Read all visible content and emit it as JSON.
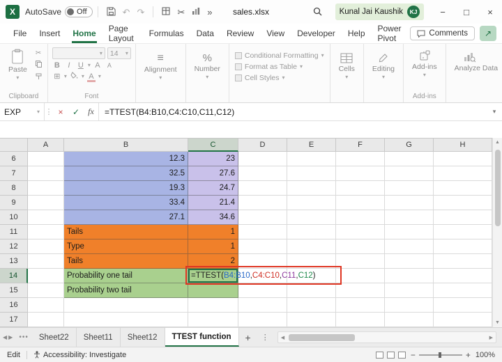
{
  "titlebar": {
    "autosave_label": "AutoSave",
    "autosave_state": "Off",
    "filename": "sales.xlsx",
    "user_name": "Kunal Jai Kaushik",
    "user_initials": "KJ"
  },
  "menubar": {
    "tabs": [
      {
        "label": "File",
        "active": false
      },
      {
        "label": "Insert",
        "active": false
      },
      {
        "label": "Home",
        "active": true
      },
      {
        "label": "Page Layout",
        "active": false
      },
      {
        "label": "Formulas",
        "active": false
      },
      {
        "label": "Data",
        "active": false
      },
      {
        "label": "Review",
        "active": false
      },
      {
        "label": "View",
        "active": false
      },
      {
        "label": "Developer",
        "active": false
      },
      {
        "label": "Help",
        "active": false
      },
      {
        "label": "Power Pivot",
        "active": false
      }
    ],
    "comments_label": "Comments"
  },
  "ribbon": {
    "paste_label": "Paste",
    "clipboard_label": "Clipboard",
    "font_label": "Font",
    "font_name": "",
    "font_size": "14",
    "bold": "B",
    "italic": "I",
    "underline": "U",
    "grow_font": "A",
    "shrink_font": "A",
    "borders_icon": "⊞",
    "alignment_label": "Alignment",
    "number_label": "Number",
    "percent_icon": "%",
    "styles": [
      "Conditional Formatting",
      "Format as Table",
      "Cell Styles"
    ],
    "cells_label": "Cells",
    "editing_label": "Editing",
    "addins_label": "Add-ins",
    "addins_group_label": "Add-ins",
    "analyze_label": "Analyze Data"
  },
  "formula_bar": {
    "name_box": "EXP",
    "formula": "=TTEST(B4:B10,C4:C10,C11,C12)"
  },
  "grid": {
    "columns": [
      "A",
      "B",
      "C",
      "D",
      "E",
      "F",
      "G",
      "H"
    ],
    "selected_cell": "C14",
    "rows": [
      {
        "num": "6",
        "b": "12.3",
        "c": "23",
        "fill": "blue"
      },
      {
        "num": "7",
        "b": "32.5",
        "c": "27.6",
        "fill": "blue"
      },
      {
        "num": "8",
        "b": "19.3",
        "c": "24.7",
        "fill": "blue"
      },
      {
        "num": "9",
        "b": "33.4",
        "c": "21.4",
        "fill": "blue"
      },
      {
        "num": "10",
        "b": "27.1",
        "c": "34.6",
        "fill": "blue"
      },
      {
        "num": "11",
        "b": "Tails",
        "c": "1",
        "fill": "orange"
      },
      {
        "num": "12",
        "b": "Type",
        "c": "1",
        "fill": "orange"
      },
      {
        "num": "13",
        "b": "Tails",
        "c": "2",
        "fill": "orange"
      },
      {
        "num": "14",
        "b": "Probability one tail",
        "c": "",
        "fill": "green",
        "formula_row": true
      },
      {
        "num": "15",
        "b": "Probability two tail",
        "c": "",
        "fill": "green"
      },
      {
        "num": "16",
        "b": "",
        "c": "",
        "fill": "none"
      },
      {
        "num": "17",
        "b": "",
        "c": "",
        "fill": "none"
      }
    ]
  },
  "cell_c14": {
    "parts": [
      {
        "text": "=TTEST(",
        "color": "#202020"
      },
      {
        "text": "B4:B10",
        "color": "#2868c8"
      },
      {
        "text": ",",
        "color": "#202020"
      },
      {
        "text": "C4:C10",
        "color": "#cf2e23"
      },
      {
        "text": ",",
        "color": "#202020"
      },
      {
        "text": "C11",
        "color": "#8e3a9e"
      },
      {
        "text": ",",
        "color": "#202020"
      },
      {
        "text": "C12",
        "color": "#1f8a4c"
      },
      {
        "text": ")",
        "color": "#202020"
      }
    ]
  },
  "sheet_tabs": {
    "tabs": [
      {
        "label": "Sheet22",
        "active": false
      },
      {
        "label": "Sheet11",
        "active": false
      },
      {
        "label": "Sheet12",
        "active": false
      },
      {
        "label": "TTEST function",
        "active": true
      }
    ]
  },
  "status_bar": {
    "mode": "Edit",
    "accessibility": "Accessibility: Investigate",
    "zoom": "100%"
  },
  "icons": {
    "dropdown": "▾",
    "undo": "↶",
    "redo": "↷",
    "cut": "✂",
    "overflow": "»",
    "minimize": "−",
    "maximize": "□",
    "close": "×",
    "cancel": "×",
    "enter": "✓",
    "fx": "fx",
    "alignment": "≡",
    "prev": "◀",
    "next": "▶",
    "more_tabs": "•••",
    "add_sheet": "+",
    "menu_dots": "⋮",
    "share_arrow": "↗",
    "zoom_minus": "−",
    "zoom_plus": "+"
  },
  "colors": {
    "accent_green": "#217346",
    "red_annotation": "#df3522",
    "blue_fill": "#a8b4e4",
    "purple_fill": "#c9c1ea",
    "orange_fill": "#f0802a",
    "green_fill": "#a9d08e"
  }
}
